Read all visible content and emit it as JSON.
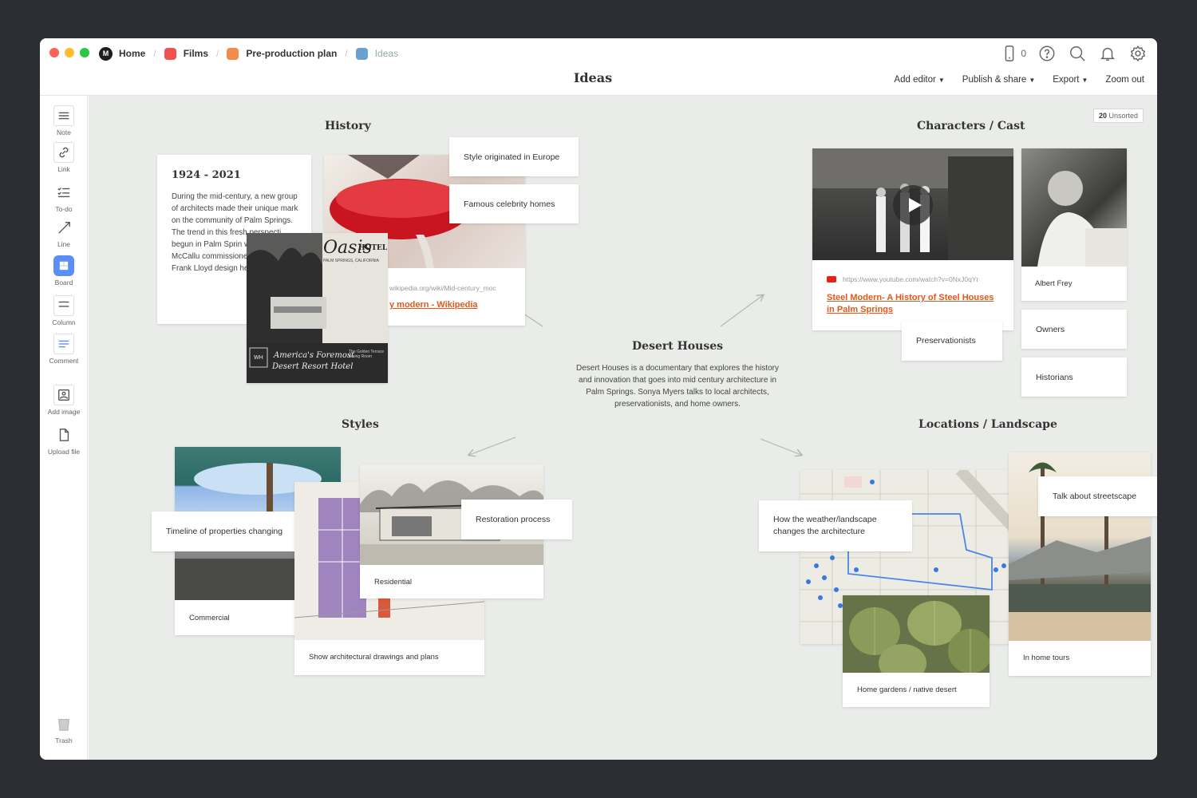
{
  "breadcrumbs": [
    {
      "label": "Home",
      "color": "#1d1d1f"
    },
    {
      "label": "Films",
      "color": "#ef5350"
    },
    {
      "label": "Pre-production plan",
      "color": "#f28c4a"
    },
    {
      "label": "Ideas",
      "color": "#6aa0cf"
    }
  ],
  "title": "Ideas",
  "device_count": "0",
  "actions": {
    "add_editor": "Add editor",
    "publish": "Publish & share",
    "export": "Export",
    "zoom": "Zoom out"
  },
  "tools": {
    "note": "Note",
    "link": "Link",
    "todo": "To-do",
    "line": "Line",
    "board": "Board",
    "column": "Column",
    "comment": "Comment",
    "add_image": "Add image",
    "upload": "Upload file",
    "trash": "Trash"
  },
  "unsorted": {
    "count": "20",
    "label": "Unsorted"
  },
  "center": {
    "title": "Desert Houses",
    "body": "Desert Houses is a documentary that explores the history and innovation that goes into mid century architecture in Palm Springs. Sonya Myers talks to local architects, preservationists, and home owners."
  },
  "history": {
    "title": "History",
    "note_title": "1924 - 2021",
    "note_body": "During the mid-century, a new group of architects made their unique mark on the community of Palm Springs. The trend in this fresh perspecti begun in Palm Sprin when Pearl McCallu commissioned Lloyd son of Frank Lloyd design her Oasis Ho",
    "tag1": "Style originated in Europe",
    "tag2": "Famous celebrity homes",
    "link_url": "wikipedia.org/wiki/Mid-century_moc",
    "link_text": "y modern - Wikipedia",
    "poster_text": "Oasis",
    "poster_hotel": "HOTEL",
    "poster_sub": "PALM SPRINGS, CALIFORNIA",
    "poster_slogan1": "America's Foremost",
    "poster_slogan2": "Desert Resort Hotel",
    "poster_wh": "WH",
    "poster_side": "The Golden Terrace Dining Room"
  },
  "characters": {
    "title": "Characters / Cast",
    "video_url": "https://www.youtube.com/watch?v=0NxJ0qYr",
    "video_link": "Steel Modern- A History of Steel Houses in Palm Springs",
    "person": "Albert Frey",
    "tag_pres": "Preservationists",
    "tag_owners": "Owners",
    "tag_hist": "Historians"
  },
  "styles": {
    "title": "Styles",
    "timeline": "Timeline of properties changing",
    "commercial": "Commercial",
    "restoration": "Restoration process",
    "residential": "Residential",
    "drawings": "Show architectural drawings and plans"
  },
  "locations": {
    "title": "Locations / Landscape",
    "weather": "How the weather/landscape changes the architecture",
    "streetscape": "Talk about streetscape",
    "tours": "In home tours",
    "gardens": "Home gardens / native desert"
  }
}
